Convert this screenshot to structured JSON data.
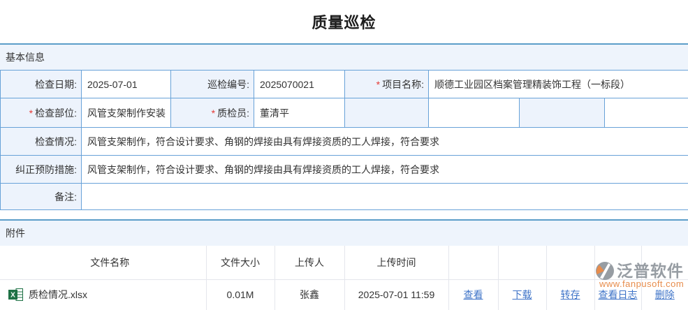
{
  "page": {
    "title": "质量巡检"
  },
  "sections": {
    "basic_info": "基本信息",
    "attachments": "附件"
  },
  "form": {
    "required_marker": "*",
    "fields": {
      "check_date": {
        "label": "检查日期:",
        "value": "2025-07-01"
      },
      "inspection_no": {
        "label": "巡检编号:",
        "value": "2025070021"
      },
      "project_name": {
        "label": "项目名称:",
        "value": "顺德工业园区档案管理精装饰工程（一标段）"
      },
      "check_part": {
        "label": "检查部位:",
        "value": "风管支架制作安装"
      },
      "inspector": {
        "label": "质检员:",
        "value": "董清平"
      },
      "check_situation": {
        "label": "检查情况:",
        "value": "风管支架制作，符合设计要求、角钢的焊接由具有焊接资质的工人焊接，符合要求"
      },
      "corrective_measures": {
        "label": "纠正预防措施:",
        "value": "风管支架制作，符合设计要求、角钢的焊接由具有焊接资质的工人焊接，符合要求"
      },
      "remarks": {
        "label": "备注:",
        "value": ""
      }
    }
  },
  "attachments": {
    "headers": [
      "文件名称",
      "文件大小",
      "上传人",
      "上传时间"
    ],
    "rows": [
      {
        "file_icon": "excel-file-icon",
        "file_name": "质检情况.xlsx",
        "file_size": "0.01M",
        "uploader": "张鑫",
        "upload_time": "2025-07-01 11:59",
        "actions": [
          "查看",
          "下载",
          "转存",
          "查看日志",
          "删除"
        ]
      }
    ]
  },
  "watermark": {
    "brand": "泛普软件",
    "url": "www.fanpusoft.com",
    "logo": "fanpu-logo-icon"
  }
}
